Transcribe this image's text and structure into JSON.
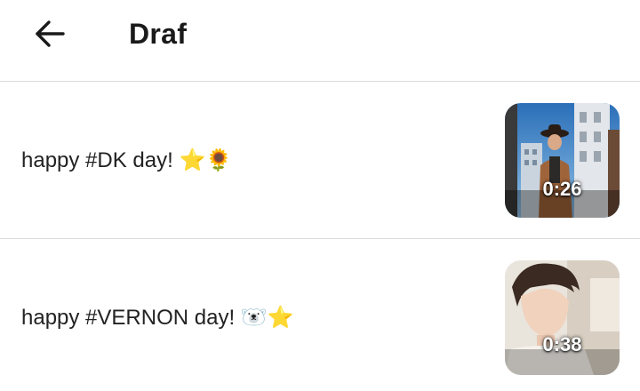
{
  "header": {
    "back_icon": "arrow-left-icon",
    "title": "Draf"
  },
  "drafts": [
    {
      "caption": "happy #DK day! ⭐🌻",
      "duration": "0:26"
    },
    {
      "caption": "happy #VERNON day! 🐻‍❄️⭐",
      "duration": "0:38"
    }
  ]
}
